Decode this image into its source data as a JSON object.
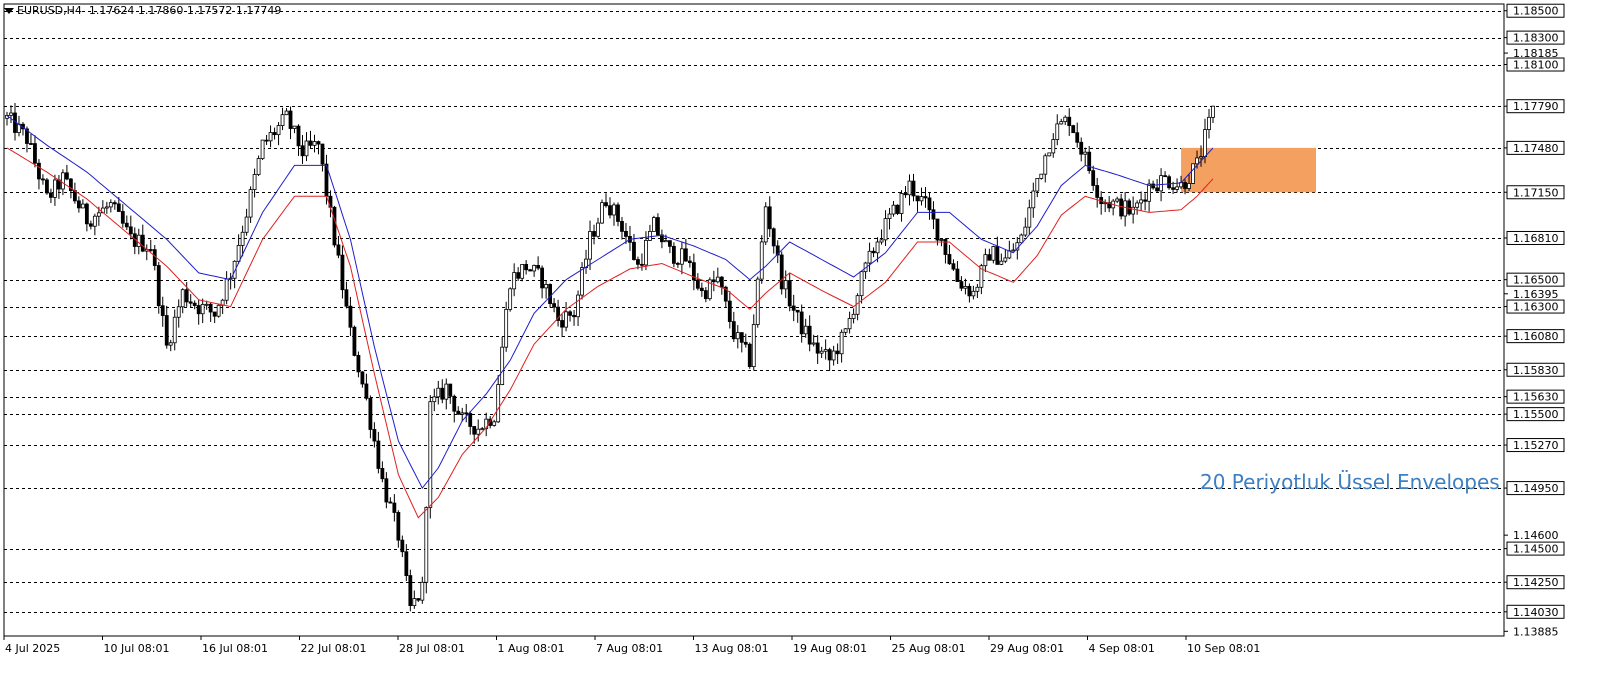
{
  "header": {
    "symbol": "EURUSD,H4",
    "ohlc": "1.17624 1.17860 1.17572 1.17749"
  },
  "annotation": "20 Periyotluk Üssel Envelopes",
  "colors": {
    "upper_envelope": "#1e1ecc",
    "lower_envelope": "#e02020",
    "zone": "#f3a060",
    "annotation": "#3d7fc1",
    "candle": "#000000"
  },
  "chart_data": {
    "type": "candlestick",
    "timeframe": "H4",
    "y_range": [
      1.1385,
      1.1855
    ],
    "x_tick_labels": [
      "4 Jul 2025",
      "10 Jul 08:01",
      "16 Jul 08:01",
      "22 Jul 08:01",
      "28 Jul 08:01",
      "1 Aug 08:01",
      "7 Aug 08:01",
      "13 Aug 08:01",
      "19 Aug 08:01",
      "25 Aug 08:01",
      "29 Aug 08:01",
      "4 Sep 08:01",
      "10 Sep 08:01"
    ],
    "y_tick_labels": [
      {
        "value": 1.185,
        "label": "1.18500",
        "boxed": true
      },
      {
        "value": 1.183,
        "label": "1.18300",
        "boxed": true
      },
      {
        "value": 1.18185,
        "label": "1.18185",
        "boxed": false
      },
      {
        "value": 1.181,
        "label": "1.18100",
        "boxed": true
      },
      {
        "value": 1.1779,
        "label": "1.17790",
        "boxed": true
      },
      {
        "value": 1.1748,
        "label": "1.17480",
        "boxed": true
      },
      {
        "value": 1.1715,
        "label": "1.17150",
        "boxed": true
      },
      {
        "value": 1.1681,
        "label": "1.16810",
        "boxed": true
      },
      {
        "value": 1.165,
        "label": "1.16500",
        "boxed": true
      },
      {
        "value": 1.16395,
        "label": "1.16395",
        "boxed": false
      },
      {
        "value": 1.163,
        "label": "1.16300",
        "boxed": true
      },
      {
        "value": 1.1608,
        "label": "1.16080",
        "boxed": true
      },
      {
        "value": 1.1583,
        "label": "1.15830",
        "boxed": true
      },
      {
        "value": 1.1563,
        "label": "1.15630",
        "boxed": true
      },
      {
        "value": 1.155,
        "label": "1.15500",
        "boxed": true
      },
      {
        "value": 1.1527,
        "label": "1.15270",
        "boxed": true
      },
      {
        "value": 1.1495,
        "label": "1.14950",
        "boxed": true
      },
      {
        "value": 1.146,
        "label": "1.14600",
        "boxed": false
      },
      {
        "value": 1.145,
        "label": "1.14500",
        "boxed": true
      },
      {
        "value": 1.1425,
        "label": "1.14250",
        "boxed": true
      },
      {
        "value": 1.1403,
        "label": "1.14030",
        "boxed": true
      },
      {
        "value": 1.13885,
        "label": "1.13885",
        "boxed": false
      }
    ],
    "horizontal_levels": [
      1.185,
      1.183,
      1.181,
      1.1779,
      1.1748,
      1.1715,
      1.1681,
      1.165,
      1.163,
      1.1608,
      1.1583,
      1.1563,
      1.155,
      1.1527,
      1.1495,
      1.145,
      1.1425,
      1.1403
    ],
    "zone": {
      "top": 1.1748,
      "bottom": 1.1715
    },
    "close_path": [
      [
        0,
        1.177
      ],
      [
        5,
        1.1755
      ],
      [
        10,
        1.171
      ],
      [
        14,
        1.1725
      ],
      [
        20,
        1.1695
      ],
      [
        26,
        1.1705
      ],
      [
        31,
        1.168
      ],
      [
        36,
        1.1675
      ],
      [
        40,
        1.16
      ],
      [
        44,
        1.164
      ],
      [
        48,
        1.163
      ],
      [
        52,
        1.1625
      ],
      [
        56,
        1.1655
      ],
      [
        60,
        1.17
      ],
      [
        64,
        1.175
      ],
      [
        70,
        1.177
      ],
      [
        74,
        1.1745
      ],
      [
        78,
        1.175
      ],
      [
        82,
        1.168
      ],
      [
        86,
        1.161
      ],
      [
        90,
        1.156
      ],
      [
        94,
        1.15
      ],
      [
        98,
        1.146
      ],
      [
        101,
        1.1405
      ],
      [
        104,
        1.142
      ],
      [
        106,
        1.1555
      ],
      [
        110,
        1.157
      ],
      [
        114,
        1.1545
      ],
      [
        118,
        1.154
      ],
      [
        122,
        1.155
      ],
      [
        126,
        1.165
      ],
      [
        130,
        1.166
      ],
      [
        134,
        1.165
      ],
      [
        138,
        1.162
      ],
      [
        142,
        1.1625
      ],
      [
        146,
        1.168
      ],
      [
        150,
        1.171
      ],
      [
        154,
        1.169
      ],
      [
        158,
        1.166
      ],
      [
        162,
        1.169
      ],
      [
        166,
        1.167
      ],
      [
        170,
        1.1665
      ],
      [
        174,
        1.164
      ],
      [
        178,
        1.165
      ],
      [
        182,
        1.161
      ],
      [
        186,
        1.159
      ],
      [
        190,
        1.1705
      ],
      [
        194,
        1.165
      ],
      [
        198,
        1.162
      ],
      [
        202,
        1.16
      ],
      [
        206,
        1.159
      ],
      [
        210,
        1.161
      ],
      [
        214,
        1.165
      ],
      [
        218,
        1.168
      ],
      [
        222,
        1.17
      ],
      [
        226,
        1.172
      ],
      [
        230,
        1.1705
      ],
      [
        234,
        1.168
      ],
      [
        238,
        1.165
      ],
      [
        242,
        1.164
      ],
      [
        246,
        1.167
      ],
      [
        250,
        1.1665
      ],
      [
        254,
        1.168
      ],
      [
        258,
        1.1725
      ],
      [
        262,
        1.176
      ],
      [
        266,
        1.177
      ],
      [
        270,
        1.174
      ],
      [
        274,
        1.171
      ],
      [
        278,
        1.1705
      ],
      [
        282,
        1.17
      ],
      [
        286,
        1.172
      ],
      [
        290,
        1.1725
      ],
      [
        294,
        1.172
      ],
      [
        298,
        1.1735
      ],
      [
        302,
        1.1775
      ]
    ],
    "envelope_upper_path": [
      [
        0,
        1.1772
      ],
      [
        10,
        1.175
      ],
      [
        20,
        1.173
      ],
      [
        30,
        1.1705
      ],
      [
        40,
        1.168
      ],
      [
        48,
        1.1655
      ],
      [
        56,
        1.165
      ],
      [
        64,
        1.17
      ],
      [
        72,
        1.1735
      ],
      [
        80,
        1.1735
      ],
      [
        86,
        1.168
      ],
      [
        92,
        1.16
      ],
      [
        98,
        1.153
      ],
      [
        104,
        1.1495
      ],
      [
        108,
        1.151
      ],
      [
        114,
        1.1545
      ],
      [
        120,
        1.1565
      ],
      [
        126,
        1.159
      ],
      [
        132,
        1.1625
      ],
      [
        140,
        1.165
      ],
      [
        148,
        1.1665
      ],
      [
        156,
        1.168
      ],
      [
        164,
        1.1683
      ],
      [
        172,
        1.1675
      ],
      [
        180,
        1.1665
      ],
      [
        186,
        1.165
      ],
      [
        190,
        1.166
      ],
      [
        196,
        1.1678
      ],
      [
        204,
        1.1665
      ],
      [
        212,
        1.1652
      ],
      [
        220,
        1.167
      ],
      [
        228,
        1.17
      ],
      [
        236,
        1.17
      ],
      [
        244,
        1.168
      ],
      [
        252,
        1.167
      ],
      [
        258,
        1.169
      ],
      [
        264,
        1.172
      ],
      [
        270,
        1.1735
      ],
      [
        278,
        1.1728
      ],
      [
        286,
        1.172
      ],
      [
        294,
        1.1722
      ],
      [
        298,
        1.1735
      ],
      [
        302,
        1.1748
      ]
    ],
    "envelope_lower_path": [
      [
        0,
        1.1748
      ],
      [
        10,
        1.173
      ],
      [
        20,
        1.171
      ],
      [
        30,
        1.1685
      ],
      [
        40,
        1.166
      ],
      [
        48,
        1.1635
      ],
      [
        56,
        1.163
      ],
      [
        64,
        1.168
      ],
      [
        72,
        1.1712
      ],
      [
        80,
        1.1712
      ],
      [
        86,
        1.166
      ],
      [
        92,
        1.158
      ],
      [
        98,
        1.1505
      ],
      [
        103,
        1.1473
      ],
      [
        108,
        1.1488
      ],
      [
        114,
        1.152
      ],
      [
        120,
        1.154
      ],
      [
        126,
        1.1568
      ],
      [
        132,
        1.1602
      ],
      [
        140,
        1.1628
      ],
      [
        148,
        1.1645
      ],
      [
        156,
        1.1658
      ],
      [
        164,
        1.1662
      ],
      [
        172,
        1.1652
      ],
      [
        180,
        1.1643
      ],
      [
        186,
        1.1628
      ],
      [
        190,
        1.164
      ],
      [
        196,
        1.1655
      ],
      [
        204,
        1.1642
      ],
      [
        212,
        1.163
      ],
      [
        220,
        1.1648
      ],
      [
        228,
        1.1678
      ],
      [
        236,
        1.1678
      ],
      [
        244,
        1.1658
      ],
      [
        252,
        1.1648
      ],
      [
        258,
        1.1668
      ],
      [
        264,
        1.1698
      ],
      [
        270,
        1.1712
      ],
      [
        278,
        1.1705
      ],
      [
        286,
        1.17
      ],
      [
        294,
        1.1702
      ],
      [
        298,
        1.1712
      ],
      [
        302,
        1.1725
      ]
    ],
    "bar_count": 303,
    "amplitude": 0.0014
  }
}
